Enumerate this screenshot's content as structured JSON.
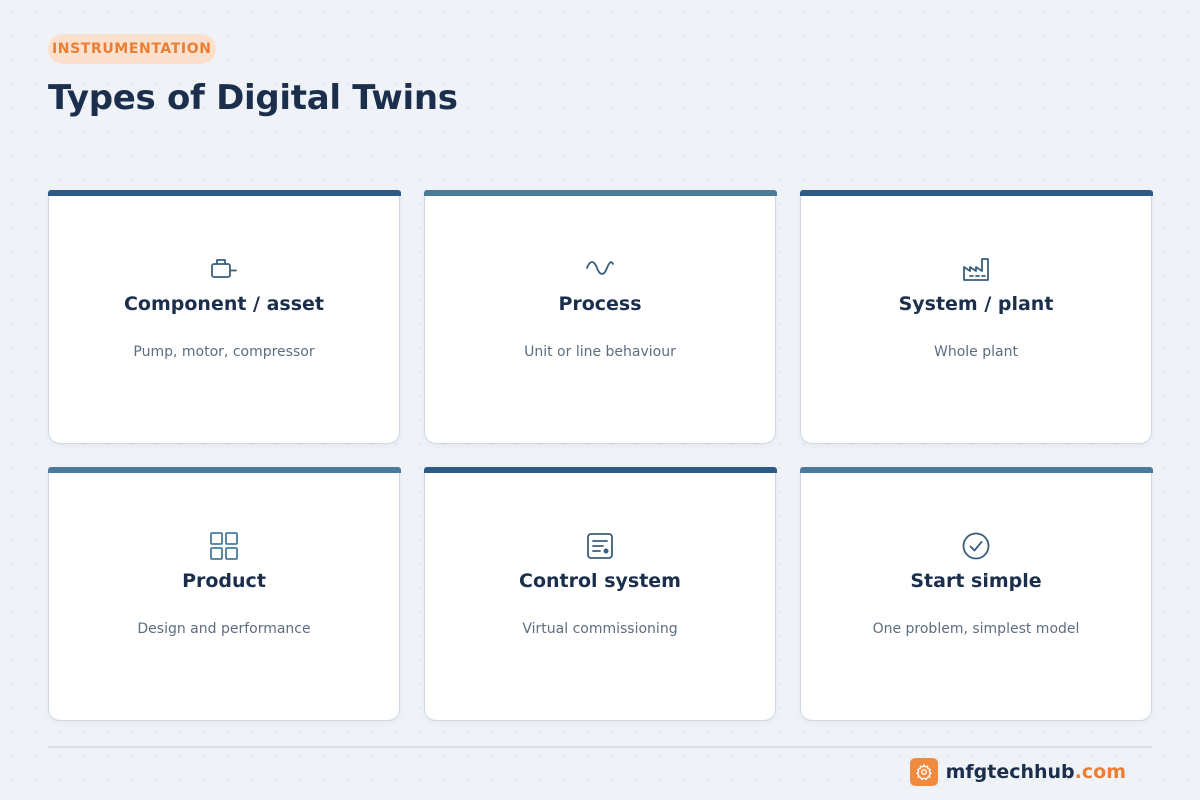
{
  "header": {
    "tag": "INSTRUMENTATION",
    "title": "Types of Digital Twins"
  },
  "cards": [
    {
      "icon": "engine-icon",
      "title": "Component / asset",
      "description": "Pump, motor, compressor",
      "accent": "#2d5a87"
    },
    {
      "icon": "wave-icon",
      "title": "Process",
      "description": "Unit or line behaviour",
      "accent": "#4b7b9b"
    },
    {
      "icon": "factory-icon",
      "title": "System / plant",
      "description": "Whole plant",
      "accent": "#2d5a87"
    },
    {
      "icon": "grid-icon",
      "title": "Product",
      "description": "Design and performance",
      "accent": "#4b7b9b"
    },
    {
      "icon": "control-panel-icon",
      "title": "Control system",
      "description": "Virtual commissioning",
      "accent": "#2d5a87"
    },
    {
      "icon": "check-circle-icon",
      "title": "Start simple",
      "description": "One problem, simplest model",
      "accent": "#4b7b9b"
    }
  ],
  "footer": {
    "brand_name": "mfgtechhub",
    "brand_tld": ".com",
    "brand_color": "#f08a3e"
  }
}
